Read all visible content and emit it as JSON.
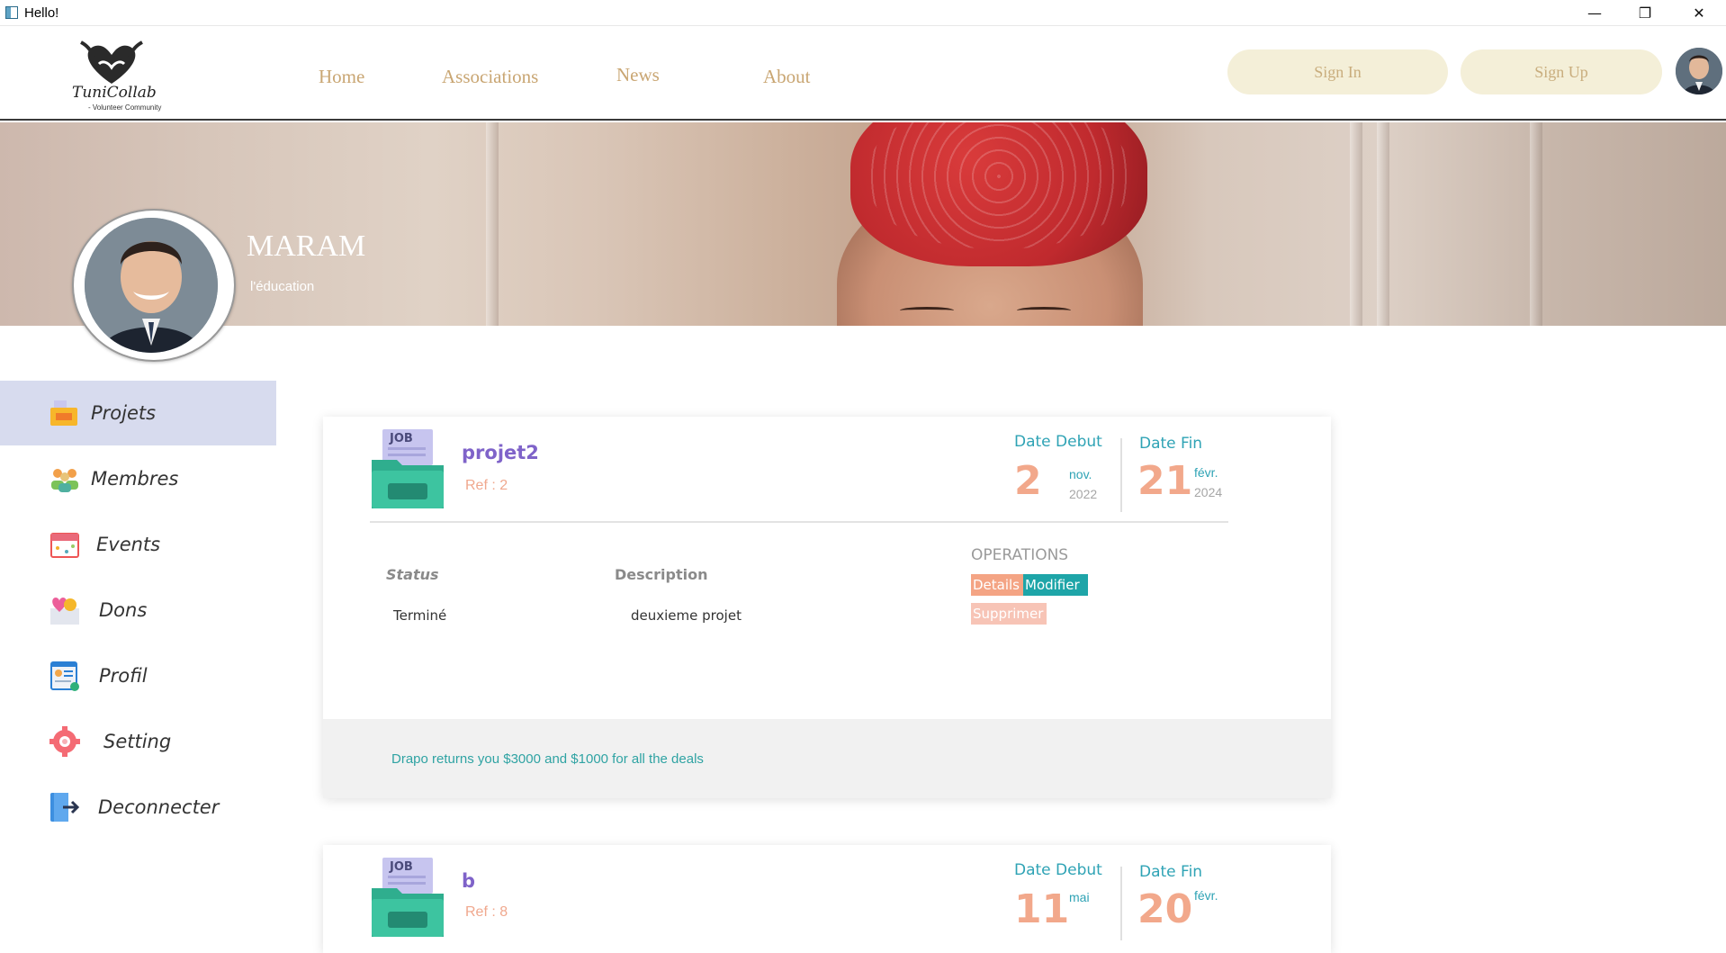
{
  "window": {
    "title": "Hello!",
    "minimize": "—",
    "restore": "❐",
    "close": "✕"
  },
  "brand": {
    "name": "TuniCollab",
    "tagline": "- Volunteer Community"
  },
  "nav": {
    "home": "Home",
    "associations": "Associations",
    "news": "News",
    "about": "About"
  },
  "auth": {
    "sign_in": "Sign In",
    "sign_up": "Sign Up"
  },
  "profile": {
    "name": "MARAM",
    "subtitle": "l'éducation"
  },
  "sidebar": {
    "items": [
      {
        "label": "Projets",
        "icon": "projects-icon",
        "active": true
      },
      {
        "label": "Membres",
        "icon": "members-icon"
      },
      {
        "label": "Events",
        "icon": "events-icon"
      },
      {
        "label": "Dons",
        "icon": "donations-icon"
      },
      {
        "label": "Profil",
        "icon": "profile-card-icon"
      },
      {
        "label": "Setting",
        "icon": "gear-icon"
      },
      {
        "label": "Deconnecter",
        "icon": "logout-icon"
      }
    ]
  },
  "projects": [
    {
      "title": "projet2",
      "ref": "Ref : 2",
      "date_debut_label": "Date Debut",
      "date_debut": {
        "day": "2",
        "month": "nov.",
        "year": "2022"
      },
      "date_fin_label": "Date Fin",
      "date_fin": {
        "day": "21",
        "month": "févr.",
        "year": "2024"
      },
      "status_header": "Status",
      "description_header": "Description",
      "status": "Terminé",
      "description": "deuxieme projet",
      "operations_label": "OPERATIONS",
      "ops": {
        "details": "Details",
        "modify": "Modifier",
        "delete": "Supprimer"
      },
      "footer": "Drapo returns you $3000 and $1000 for all the deals"
    },
    {
      "title": "b",
      "ref": "Ref : 8",
      "date_debut_label": "Date Debut",
      "date_debut": {
        "day": "11",
        "month": "mai"
      },
      "date_fin_label": "Date Fin",
      "date_fin": {
        "day": "20",
        "month": "févr."
      }
    }
  ],
  "colors": {
    "accent_teal": "#2fa3b5",
    "accent_peach": "#f2a88b",
    "accent_purple": "#7f63c9",
    "sidebar_active": "#d7dbee"
  }
}
